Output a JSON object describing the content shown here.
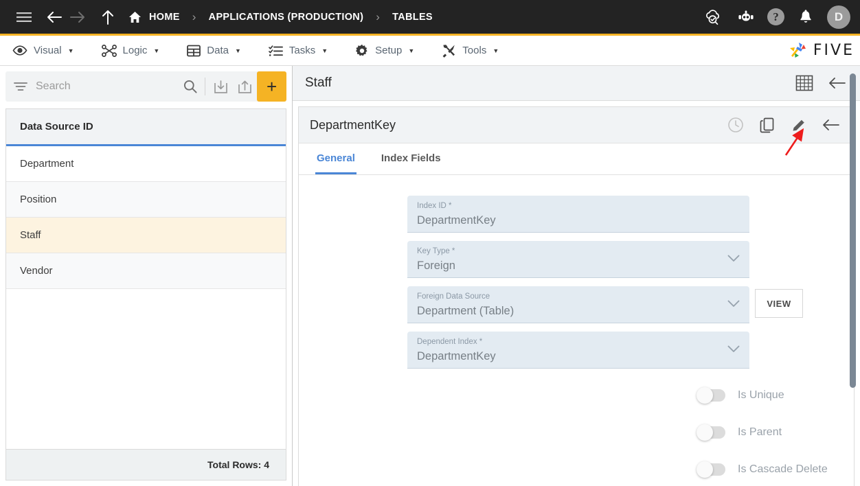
{
  "topbar": {
    "menu_icon": "hamburger-icon",
    "back_icon": "arrow-left-icon",
    "forward_icon": "arrow-right-icon",
    "up_icon": "arrow-up-icon",
    "breadcrumb": [
      {
        "label": "HOME",
        "icon": "home-icon"
      },
      {
        "label": "APPLICATIONS (PRODUCTION)",
        "icon": ""
      },
      {
        "label": "TABLES",
        "icon": ""
      }
    ],
    "separator": "›",
    "actions": [
      {
        "name": "cloud-check-icon"
      },
      {
        "name": "robot-icon"
      },
      {
        "name": "help-icon",
        "label": "?"
      },
      {
        "name": "bell-icon"
      }
    ],
    "avatar_initial": "D",
    "accent_color": "#f5b324",
    "bar_color": "#232323"
  },
  "menubar": {
    "items": [
      {
        "label": "Visual",
        "icon": "eye-icon",
        "caret": "▼"
      },
      {
        "label": "Logic",
        "icon": "logic-nodes-icon",
        "caret": "▼"
      },
      {
        "label": "Data",
        "icon": "table-icon",
        "caret": "▼"
      },
      {
        "label": "Tasks",
        "icon": "checklist-icon",
        "caret": "▼"
      },
      {
        "label": "Setup",
        "icon": "gear-icon",
        "caret": "▼"
      },
      {
        "label": "Tools",
        "icon": "tools-icon",
        "caret": "▼"
      }
    ],
    "logo_text": "FIVE"
  },
  "sidebar": {
    "search": {
      "placeholder": "Search",
      "value": ""
    },
    "toolbar": [
      {
        "name": "filter-icon"
      },
      {
        "name": "search-icon"
      },
      {
        "name": "import-icon"
      },
      {
        "name": "export-icon"
      },
      {
        "name": "add-button",
        "label": "+"
      }
    ],
    "table": {
      "column_header": "Data Source ID",
      "rows": [
        {
          "label": "Department",
          "selected": false
        },
        {
          "label": "Position",
          "selected": false
        },
        {
          "label": "Staff",
          "selected": true
        },
        {
          "label": "Vendor",
          "selected": false
        }
      ],
      "footer": "Total Rows: 4",
      "header_underline_color": "#4a86d6",
      "selected_row_color": "#fdf3e0"
    }
  },
  "main": {
    "panel_title": "Staff",
    "panel_actions": [
      {
        "name": "grid-view-icon"
      },
      {
        "name": "back-arrow-icon"
      }
    ],
    "record_title": "DepartmentKey",
    "record_actions": [
      {
        "name": "history-clock-icon"
      },
      {
        "name": "copy-icon"
      },
      {
        "name": "edit-pencil-icon"
      },
      {
        "name": "back-arrow-icon"
      }
    ],
    "tabs": [
      {
        "label": "General",
        "active": true
      },
      {
        "label": "Index Fields",
        "active": false
      }
    ],
    "active_tab_color": "#4a86d6",
    "fields": [
      {
        "label": "Index ID *",
        "value": "DepartmentKey",
        "type": "text",
        "has_chevron": false,
        "side_button": null
      },
      {
        "label": "Key Type *",
        "value": "Foreign",
        "type": "select",
        "has_chevron": true,
        "side_button": null
      },
      {
        "label": "Foreign Data Source",
        "value": "Department (Table)",
        "type": "select",
        "has_chevron": true,
        "side_button": "VIEW"
      },
      {
        "label": "Dependent Index *",
        "value": "DepartmentKey",
        "type": "select",
        "has_chevron": true,
        "side_button": null
      }
    ],
    "toggles": [
      {
        "label": "Is Unique",
        "on": false
      },
      {
        "label": "Is Parent",
        "on": false
      },
      {
        "label": "Is Cascade Delete",
        "on": false
      }
    ],
    "annotation": {
      "name": "red-arrow-annotation",
      "color": "#ee1c1c",
      "points_at": "edit-pencil-icon"
    }
  }
}
